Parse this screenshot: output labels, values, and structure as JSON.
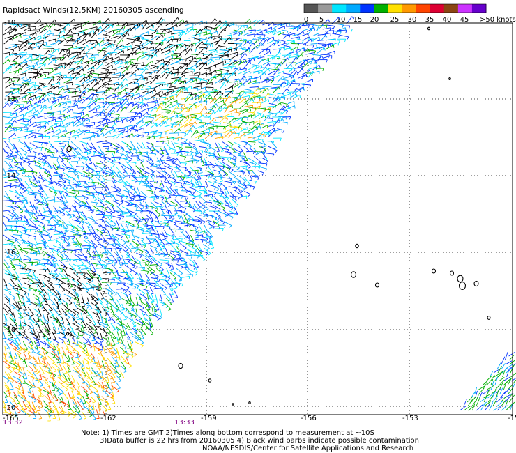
{
  "title": "Rapidsact Winds(12.5KM) 20160305 ascending",
  "legend": {
    "colors": [
      "#555555",
      "#9a9a9a",
      "#00e6ff",
      "#00aaff",
      "#0033ff",
      "#00b000",
      "#ffe000",
      "#ff9900",
      "#ff4400",
      "#dd0033",
      "#8b4513",
      "#cc33ff",
      "#6600cc"
    ],
    "labels": [
      "0",
      "5",
      "10",
      "15",
      "20",
      "25",
      "30",
      "35",
      "40",
      "45",
      ">50 knots"
    ]
  },
  "axes": {
    "x_ticks": [
      "-165",
      "-162",
      "-159",
      "-156",
      "-153",
      "-15"
    ],
    "y_ticks": [
      "-10",
      "-12",
      "-14",
      "-16",
      "-18",
      "-20"
    ]
  },
  "swath_times": [
    "13:32",
    "13:33"
  ],
  "notes": [
    "Note: 1) Times are GMT 2)Times along bottom correspond to measurement at ~10S",
    "3)Data buffer is 22 hrs from 20160305 4) Black wind barbs indicate possible contamination",
    "NOAA/NESDIS/Center for Satellite Applications and Research"
  ]
}
